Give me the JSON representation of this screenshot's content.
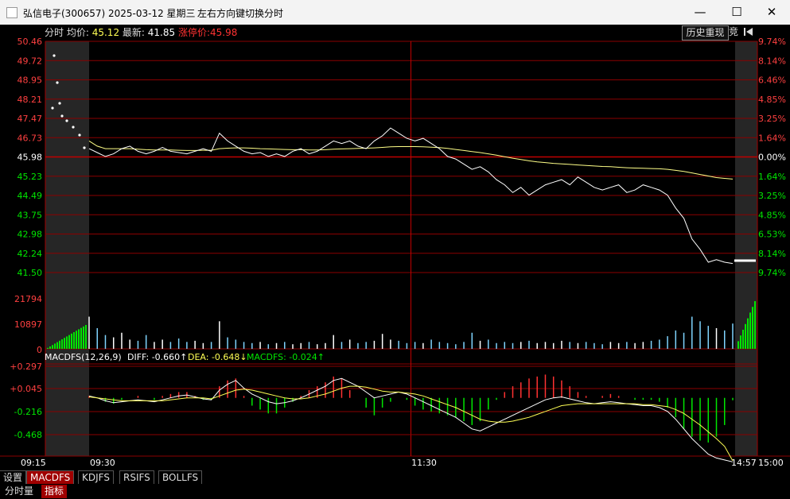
{
  "window": {
    "title": "弘信电子(300657) 2025-03-12 星期三",
    "hint": "左右方向键切换分时",
    "minimize": "—",
    "maximize": "☐",
    "close": "✕"
  },
  "header": {
    "mode": "分时",
    "avg_label": "均价:",
    "avg_value": "45.12",
    "last_label": "最新:",
    "last_value": "41.85",
    "limit_label": "涨停价:",
    "limit_value": "45.98",
    "history_button": "历史重现",
    "auction_button": "竞"
  },
  "price_axis": {
    "left": [
      "50.46",
      "49.72",
      "48.95",
      "48.21",
      "47.47",
      "46.73",
      "45.98",
      "45.23",
      "44.49",
      "43.75",
      "42.98",
      "42.24",
      "41.50"
    ],
    "right": [
      "9.74%",
      "8.14%",
      "6.46%",
      "4.85%",
      "3.25%",
      "1.64%",
      "0.00%",
      "1.64%",
      "3.25%",
      "4.85%",
      "6.53%",
      "8.14%",
      "9.74%"
    ]
  },
  "volume_axis": [
    "21794",
    "10897",
    "0"
  ],
  "macd": {
    "title": "MACDFS(12,26,9)",
    "diff": "DIFF: -0.660↑",
    "dea": "DEA: -0.648↓",
    "macdfs": "MACDFS: -0.024↑",
    "axis": [
      "+0.297",
      "+0.045",
      "-0.216",
      "-0.468"
    ]
  },
  "time_axis": [
    "09:15",
    "09:30",
    "11:30",
    "14:57",
    "15:00"
  ],
  "tabs": [
    "设置",
    "MACDFS",
    "KDJFS",
    "RSIFS",
    "BOLLFS"
  ],
  "bottom_tabs": [
    "分时量",
    "指标"
  ],
  "colors": {
    "up": "#ff3232",
    "down": "#00e600",
    "grid": "#8b0000",
    "price": "#ffffff",
    "avg": "#ffff55"
  },
  "chart_data": {
    "type": "line",
    "series": [
      {
        "values": [
          46.3,
          46.15,
          46.0,
          46.1,
          46.3,
          46.4,
          46.2,
          46.1,
          46.2,
          46.35,
          46.2,
          46.15,
          46.1,
          46.2,
          46.3,
          46.2,
          46.9,
          46.6,
          46.4,
          46.2,
          46.1,
          46.15,
          46.0,
          46.1,
          46.0,
          46.2,
          46.3,
          46.1,
          46.2,
          46.4,
          46.6,
          46.5,
          46.6,
          46.4,
          46.3,
          46.6,
          46.8,
          47.1,
          46.9,
          46.7,
          46.6,
          46.7,
          46.5,
          46.3,
          46.0,
          45.9,
          45.7,
          45.5,
          45.6,
          45.4,
          45.1,
          44.9,
          44.6,
          44.8,
          44.5,
          44.7,
          44.9,
          45.0,
          45.1,
          44.9,
          45.2,
          45.0,
          44.8,
          44.7,
          44.8,
          44.9,
          44.6,
          44.7,
          44.9,
          44.8,
          44.7,
          44.5,
          44.0,
          43.6,
          42.8,
          42.4,
          41.9,
          42.0,
          41.9,
          41.85
        ]
      },
      {
        "values": [
          46.6,
          46.4,
          46.3,
          46.3,
          46.3,
          46.3,
          46.28,
          46.26,
          46.25,
          46.25,
          46.25,
          46.24,
          46.23,
          46.23,
          46.24,
          46.24,
          46.3,
          46.32,
          46.33,
          46.33,
          46.32,
          46.3,
          46.29,
          46.28,
          46.27,
          46.26,
          46.26,
          46.25,
          46.25,
          46.26,
          46.28,
          46.29,
          46.3,
          46.31,
          46.32,
          46.33,
          46.35,
          46.37,
          46.38,
          46.38,
          46.38,
          46.37,
          46.36,
          46.34,
          46.31,
          46.27,
          46.23,
          46.19,
          46.15,
          46.1,
          46.05,
          45.99,
          45.93,
          45.88,
          45.83,
          45.79,
          45.76,
          45.73,
          45.71,
          45.69,
          45.67,
          45.65,
          45.63,
          45.61,
          45.6,
          45.58,
          45.56,
          45.55,
          45.54,
          45.53,
          45.52,
          45.5,
          45.46,
          45.42,
          45.36,
          45.3,
          45.24,
          45.18,
          45.15,
          45.12
        ]
      }
    ],
    "volume": [
      14000,
      9000,
      6000,
      5000,
      7000,
      4000,
      3500,
      6000,
      3000,
      4000,
      3000,
      4500,
      3000,
      3500,
      2500,
      3000,
      12000,
      5000,
      4000,
      3000,
      2500,
      3000,
      2000,
      2500,
      3000,
      2000,
      2500,
      3000,
      2000,
      2500,
      6000,
      3000,
      4000,
      2500,
      3000,
      3500,
      6500,
      4000,
      3500,
      2500,
      3000,
      2500,
      4000,
      3000,
      2500,
      2000,
      3000,
      7000,
      3500,
      4000,
      2500,
      3000,
      2500,
      3000,
      3500,
      2500,
      3000,
      2500,
      3500,
      3000,
      2500,
      3000,
      2500,
      2000,
      3000,
      2500,
      3000,
      2500,
      3000,
      3500,
      4000,
      5500,
      8000,
      7000,
      14000,
      12000,
      10000,
      9000,
      8000,
      11000
    ],
    "macd_diff": [
      0.02,
      0.0,
      -0.03,
      -0.05,
      -0.04,
      -0.03,
      -0.02,
      -0.03,
      -0.04,
      -0.02,
      0.0,
      0.02,
      0.03,
      0.01,
      -0.01,
      -0.02,
      0.08,
      0.14,
      0.18,
      0.1,
      0.04,
      0.0,
      -0.04,
      -0.06,
      -0.05,
      -0.03,
      0.0,
      0.04,
      0.08,
      0.12,
      0.18,
      0.2,
      0.16,
      0.12,
      0.06,
      0.0,
      0.02,
      0.04,
      0.06,
      0.04,
      0.0,
      -0.04,
      -0.08,
      -0.12,
      -0.16,
      -0.2,
      -0.26,
      -0.32,
      -0.34,
      -0.3,
      -0.26,
      -0.22,
      -0.18,
      -0.14,
      -0.1,
      -0.06,
      -0.02,
      0.0,
      0.01,
      -0.01,
      -0.03,
      -0.05,
      -0.06,
      -0.05,
      -0.04,
      -0.05,
      -0.06,
      -0.07,
      -0.08,
      -0.08,
      -0.1,
      -0.14,
      -0.22,
      -0.32,
      -0.42,
      -0.5,
      -0.58,
      -0.62,
      -0.64,
      -0.66
    ],
    "macd_dea": [
      0.01,
      0.0,
      -0.01,
      -0.02,
      -0.03,
      -0.03,
      -0.03,
      -0.03,
      -0.03,
      -0.03,
      -0.02,
      -0.01,
      0.0,
      0.0,
      0.0,
      -0.01,
      0.02,
      0.05,
      0.08,
      0.09,
      0.08,
      0.06,
      0.04,
      0.02,
      0.0,
      -0.01,
      -0.01,
      0.0,
      0.02,
      0.04,
      0.07,
      0.1,
      0.12,
      0.12,
      0.11,
      0.09,
      0.07,
      0.06,
      0.06,
      0.05,
      0.04,
      0.02,
      -0.01,
      -0.04,
      -0.07,
      -0.1,
      -0.14,
      -0.18,
      -0.22,
      -0.24,
      -0.25,
      -0.25,
      -0.24,
      -0.22,
      -0.2,
      -0.17,
      -0.14,
      -0.11,
      -0.08,
      -0.07,
      -0.06,
      -0.06,
      -0.06,
      -0.06,
      -0.06,
      -0.06,
      -0.06,
      -0.06,
      -0.07,
      -0.07,
      -0.08,
      -0.09,
      -0.12,
      -0.16,
      -0.22,
      -0.28,
      -0.35,
      -0.42,
      -0.5,
      -0.648
    ],
    "ylim_price": [
      41.5,
      50.46
    ],
    "ylim_volume": [
      0,
      21794
    ],
    "ylim_macd": [
      -0.6,
      0.35
    ]
  }
}
